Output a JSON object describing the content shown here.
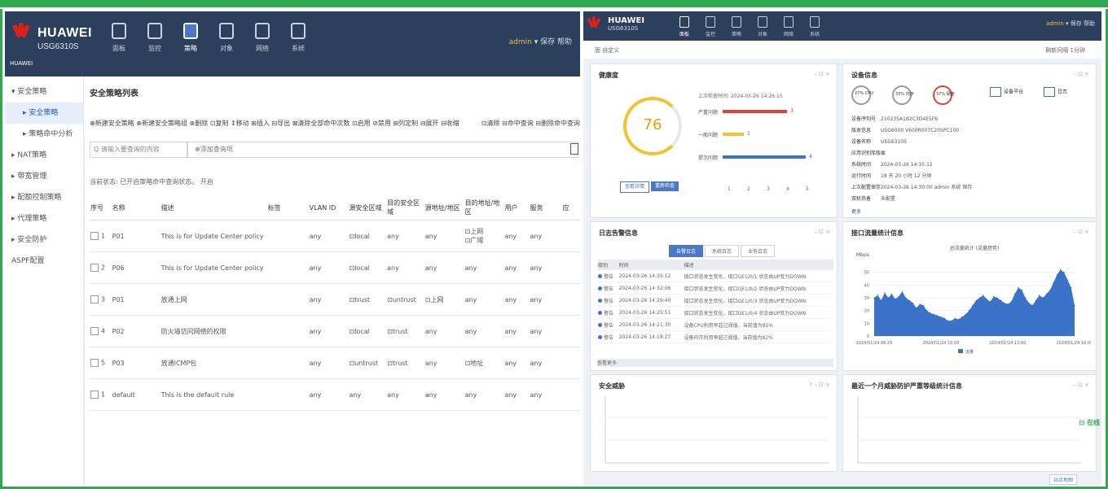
{
  "left": {
    "brand": "HUAWEI",
    "model": "USG6310S",
    "brand_small": "HUAWEI",
    "nav_tabs": [
      "面板",
      "监控",
      "策略",
      "对象",
      "网络",
      "系统"
    ],
    "user": "admin",
    "user_links": "▾ 保存 帮助",
    "sidebar": [
      {
        "label": "▾ 安全策略",
        "sub": false,
        "active": false
      },
      {
        "label": "▸ 安全策略",
        "sub": true,
        "active": true
      },
      {
        "label": "▸ 策略命中分析",
        "sub": true,
        "active": false
      },
      {
        "label": "▸ NAT策略",
        "sub": false,
        "active": false
      },
      {
        "label": "▸ 带宽管理",
        "sub": false,
        "active": false
      },
      {
        "label": "▸ 配额控制策略",
        "sub": false,
        "active": false
      },
      {
        "label": "▸ 代理策略",
        "sub": false,
        "active": false
      },
      {
        "label": "▸ 安全防护",
        "sub": false,
        "active": false
      },
      {
        "label": "ASPF配置",
        "sub": false,
        "active": false
      }
    ],
    "page_title": "安全策略列表",
    "toolbar": "⊕新建安全策略 ⊕新建安全策略组 ⊗删除 ⊡复制 ↕移动 ⊞插入 ⊟导出 ⊠清除全部命中次数 ⊡启用 ⊘禁用 ⊞列定制 ⊟展开 ⊟收缩",
    "toolbar_right": "⊡清除 ⊟命中查询 ⊟删除命中查询",
    "search_placeholder": "Q 请输入要查询的内容",
    "search2_placeholder": "⊕添加查询项",
    "filter_info": "当前状态: 已开启策略命中查询状态。 开启",
    "columns": [
      "序号",
      "名称",
      "描述",
      "标签",
      "VLAN ID",
      "源安全区域",
      "目的安全区域",
      "源地址/地区",
      "目的地址/地区",
      "用户",
      "服务",
      "应"
    ],
    "rows": [
      {
        "no": "1",
        "name": "P01",
        "desc": "This is for Update Center policy",
        "vlan": "any",
        "src_zone": "⊡local",
        "dst_zone": "any",
        "src_addr": "any",
        "dst_addr": "⊡上网\n⊡广域",
        "user": "any",
        "svc": "any"
      },
      {
        "no": "2",
        "name": "P06",
        "desc": "This is for Update Center policy",
        "vlan": "any",
        "src_zone": "⊡local",
        "dst_zone": "any",
        "src_addr": "any",
        "dst_addr": "any",
        "user": "any",
        "svc": "any"
      },
      {
        "no": "3",
        "name": "P01",
        "desc": "放通上网",
        "vlan": "any",
        "src_zone": "⊡trust",
        "dst_zone": "⊡untrust",
        "src_addr": "⊡上网",
        "dst_addr": "any",
        "user": "any",
        "svc": "any"
      },
      {
        "no": "4",
        "name": "P02",
        "desc": "防火墙访问网络的权限",
        "vlan": "any",
        "src_zone": "⊡local",
        "dst_zone": "⊡trust",
        "src_addr": "any",
        "dst_addr": "any",
        "user": "any",
        "svc": "any"
      },
      {
        "no": "5",
        "name": "P03",
        "desc": "放通ICMP包",
        "vlan": "any",
        "src_zone": "⊡untrust",
        "dst_zone": "⊡trust",
        "src_addr": "any",
        "dst_addr": "⊡地址",
        "user": "any",
        "svc": "any"
      },
      {
        "no": "1",
        "name": "default",
        "desc": "This is the default rule",
        "vlan": "any",
        "src_zone": "any",
        "dst_zone": "any",
        "src_addr": "any",
        "dst_addr": "any",
        "user": "any",
        "svc": "any"
      }
    ]
  },
  "right": {
    "brand": "HUAWEI",
    "model": "USG6310S",
    "nav_tabs": [
      "面板",
      "监控",
      "策略",
      "对象",
      "网络",
      "系统"
    ],
    "user": "admin",
    "user_links": "▾ 保存 帮助",
    "crumb_left": "面 自定义",
    "crumb_right": "刷新间隔 1分钟",
    "health": {
      "title": "健康度",
      "score": "76",
      "check_time": "上次检查时间: 2024-03-26 14:26:15",
      "rows": [
        {
          "label": "严重问题",
          "value": "3",
          "color": "#e0403a",
          "frac": 0.72
        },
        {
          "label": "一般问题",
          "value": "1",
          "color": "#f1c232",
          "frac": 0.24
        },
        {
          "label": "提示问题",
          "value": "4",
          "color": "#3b73c8",
          "frac": 0.93
        }
      ],
      "axis": [
        "1",
        "2",
        "3",
        "4",
        "5"
      ],
      "btn_detail": "查看详情",
      "btn_check": "重新检查"
    },
    "device": {
      "title": "设备信息",
      "circles": [
        "27% CPU",
        "33% 内存",
        "37% 硬盘"
      ],
      "icons": [
        "设备平台",
        "日志"
      ],
      "kv": [
        {
          "k": "设备序列号",
          "v": "210235A1B2C3D4E5F6"
        },
        {
          "k": "版本信息",
          "v": "USG6000 V600R007C20SPC100"
        },
        {
          "k": "设备名称",
          "v": "USG6310S"
        },
        {
          "k": "应用识别库版本",
          "v": "--"
        },
        {
          "k": "系统时间",
          "v": "2024-03-26 14:35:12"
        },
        {
          "k": "运行时间",
          "v": "18 天 20 小时 12 分钟"
        },
        {
          "k": "上次配置保存",
          "v": "2024-03-26 14:30:00 admin 系统 保存"
        },
        {
          "k": "双机热备",
          "v": "未配置"
        }
      ],
      "more": "更多"
    },
    "logs": {
      "title": "日志告警信息",
      "tabs": [
        "告警日志",
        "系统日志",
        "业务日志"
      ],
      "headers": [
        "级别",
        "时间",
        "描述"
      ],
      "rows": [
        {
          "lvl": "警告",
          "time": "2024-03-26 14:35:12",
          "desc": "接口状态发生变化，接口GE1/0/1 状态由UP变为DOWN"
        },
        {
          "lvl": "警告",
          "time": "2024-03-26 14:32:06",
          "desc": "接口状态发生变化，接口GE1/0/2 状态由UP变为DOWN"
        },
        {
          "lvl": "警告",
          "time": "2024-03-26 14:29:40",
          "desc": "接口状态发生变化，接口GE1/0/3 状态由UP变为DOWN"
        },
        {
          "lvl": "警告",
          "time": "2024-03-26 14:25:51",
          "desc": "接口状态发生变化，接口GE1/0/4 状态由UP变为DOWN"
        },
        {
          "lvl": "警告",
          "time": "2024-03-26 14:21:30",
          "desc": "设备CPU利用率超过阈值，当前值为85%"
        },
        {
          "lvl": "警告",
          "time": "2024-03-26 14:18:27",
          "desc": "设备内存利用率超过阈值，当前值为82%"
        }
      ],
      "more": "查看更多"
    },
    "traffic": {
      "title": "接口流量统计信息",
      "subtitle": "总流量统计 (流量趋势)",
      "unit": "Mbps",
      "legend": "流量",
      "color": "#3b73c8"
    },
    "security": {
      "title": "安全威胁"
    },
    "risk": {
      "title": "最近一个月威胁防护严重等级统计信息"
    },
    "chat": "⊡ 在线",
    "bottom_link": "站点地图"
  },
  "chart_data": {
    "type": "area",
    "title": "总流量统计 (流量趋势)",
    "ylabel": "Mbps",
    "legend": [
      "流量"
    ],
    "ylim": [
      0,
      60
    ],
    "x_ticks": [
      "2024/01/24 08:20",
      "2024/01/24 10:00",
      "2024/01/24 13:00",
      "2024/01/24 16:00"
    ],
    "y_ticks": [
      "0",
      "10",
      "20",
      "30",
      "40",
      "50"
    ],
    "series": [
      {
        "name": "流量",
        "values": [
          30,
          32,
          28,
          34,
          30,
          33,
          29,
          31,
          35,
          30,
          28,
          26,
          22,
          25,
          24,
          20,
          18,
          17,
          16,
          15,
          14,
          12,
          12,
          14,
          13,
          15,
          17,
          20,
          24,
          28,
          30,
          32,
          29,
          27,
          31,
          30,
          28,
          26,
          25,
          27,
          33,
          38,
          36,
          30,
          26,
          24,
          28,
          32,
          30,
          33,
          36,
          42,
          48,
          52,
          50,
          44,
          38,
          24
        ]
      }
    ]
  }
}
